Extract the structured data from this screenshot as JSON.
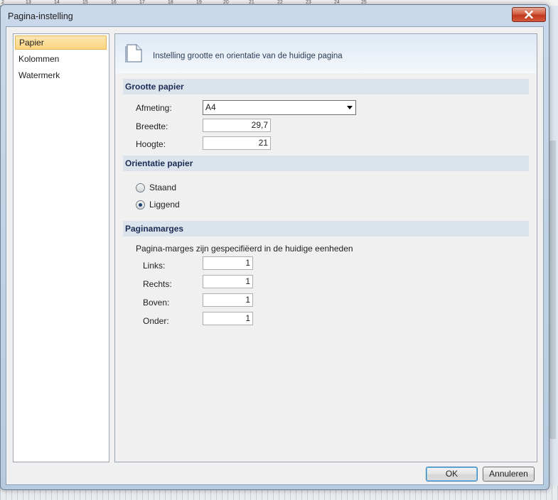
{
  "window": {
    "title": "Pagina-instelling"
  },
  "background": {
    "ruler_ticks": [
      "2",
      "13",
      "14",
      "15",
      "16",
      "17",
      "18",
      "19",
      "20",
      "21",
      "22",
      "23",
      "24",
      "25"
    ]
  },
  "nav": {
    "items": [
      {
        "label": "Papier",
        "selected": true
      },
      {
        "label": "Kolommen",
        "selected": false
      },
      {
        "label": "Watermerk",
        "selected": false
      }
    ]
  },
  "header": {
    "text": "Instelling grootte en orientatie van de huidige pagina"
  },
  "paper_size": {
    "section_title": "Grootte papier",
    "size_label": "Afmeting:",
    "size_value": "A4",
    "width_label": "Breedte:",
    "width_value": "29,7",
    "height_label": "Hoogte:",
    "height_value": "21"
  },
  "orientation": {
    "section_title": "Orientatie papier",
    "portrait_label": "Staand",
    "landscape_label": "Liggend",
    "selected": "landscape"
  },
  "margins": {
    "section_title": "Paginamarges",
    "description": "Pagina-marges zijn gespecifiëerd in de huidige eenheden",
    "left_label": "Links:",
    "left_value": "1",
    "right_label": "Rechts:",
    "right_value": "1",
    "top_label": "Boven:",
    "top_value": "1",
    "bottom_label": "Onder:",
    "bottom_value": "1"
  },
  "buttons": {
    "ok_label": "OK",
    "cancel_label": "Annuleren"
  },
  "colors": {
    "selection_fill": "#fbd47e",
    "section_header": "#dbe3ec",
    "section_text": "#1b2c55",
    "close_button": "#c0391d"
  }
}
